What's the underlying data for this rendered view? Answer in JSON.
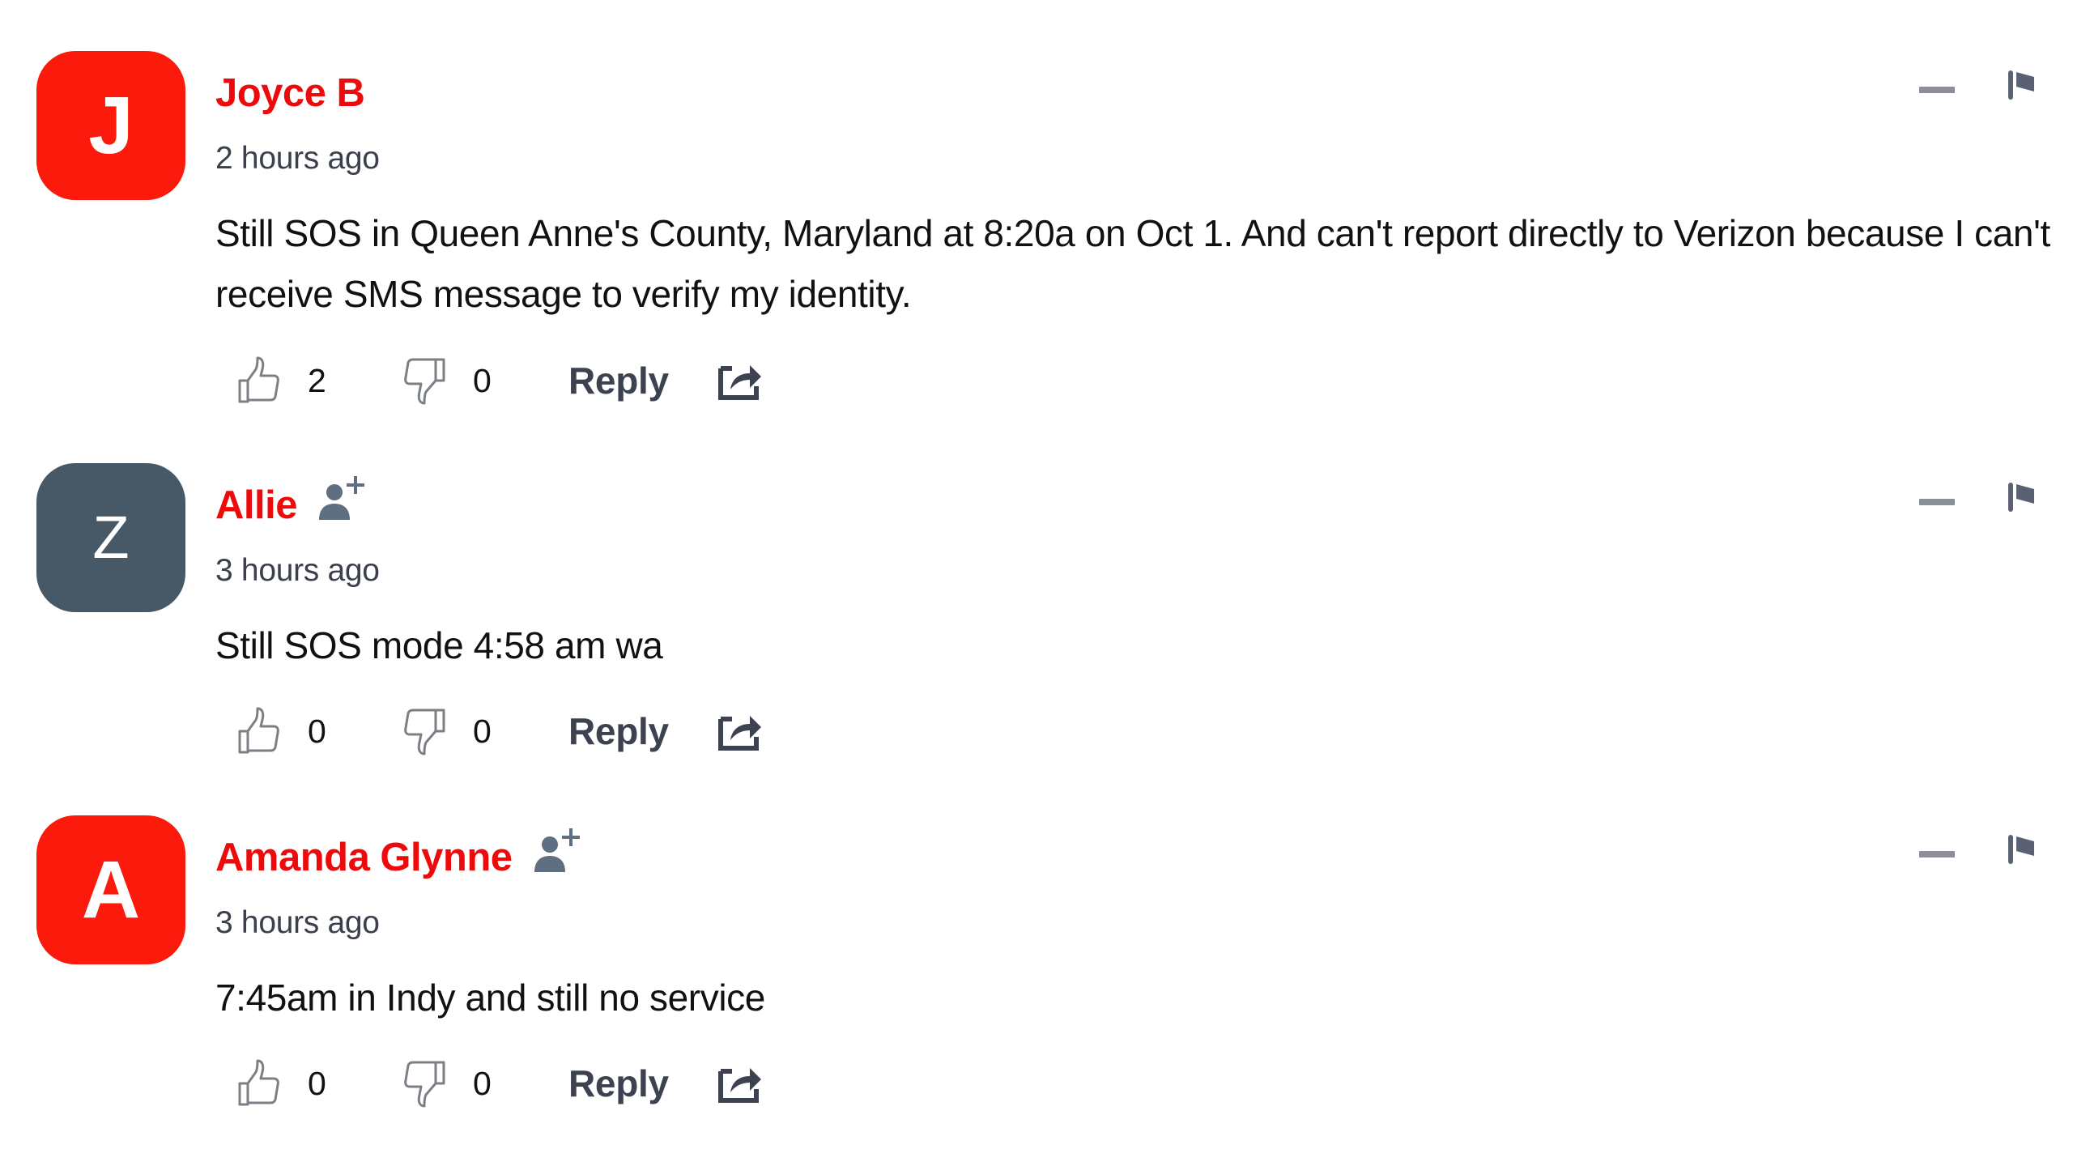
{
  "colors": {
    "accent_red": "#ee0a0a",
    "avatar_red": "#fb1a0c",
    "avatar_grey": "#475866",
    "icon_grey": "#5d6f80"
  },
  "comments": [
    {
      "avatar_letter": "J",
      "avatar_color": "red",
      "author": "Joyce B",
      "show_follow_icon": false,
      "timestamp": "2 hours ago",
      "text": "Still SOS in Queen Anne's County, Maryland at 8:20a on Oct 1. And can't report directly to Verizon because I can't receive SMS message to verify my identity.",
      "likes": "2",
      "dislikes": "0",
      "reply_label": "Reply",
      "icons": {
        "like": "thumbs-up-icon",
        "dislike": "thumbs-down-icon",
        "share": "share-icon",
        "collapse": "minus-icon",
        "report": "flag-icon"
      }
    },
    {
      "avatar_letter": "Z",
      "avatar_color": "grey",
      "author": "Allie",
      "show_follow_icon": true,
      "timestamp": "3 hours ago",
      "text": "Still SOS mode 4:58 am wa",
      "likes": "0",
      "dislikes": "0",
      "reply_label": "Reply",
      "icons": {
        "like": "thumbs-up-icon",
        "dislike": "thumbs-down-icon",
        "share": "share-icon",
        "collapse": "minus-icon",
        "report": "flag-icon",
        "follow": "add-user-icon"
      }
    },
    {
      "avatar_letter": "A",
      "avatar_color": "red",
      "author": "Amanda Glynne",
      "show_follow_icon": true,
      "timestamp": "3 hours ago",
      "text": "7:45am in Indy and still no service",
      "likes": "0",
      "dislikes": "0",
      "reply_label": "Reply",
      "icons": {
        "like": "thumbs-up-icon",
        "dislike": "thumbs-down-icon",
        "share": "share-icon",
        "collapse": "minus-icon",
        "report": "flag-icon",
        "follow": "add-user-icon"
      }
    }
  ]
}
